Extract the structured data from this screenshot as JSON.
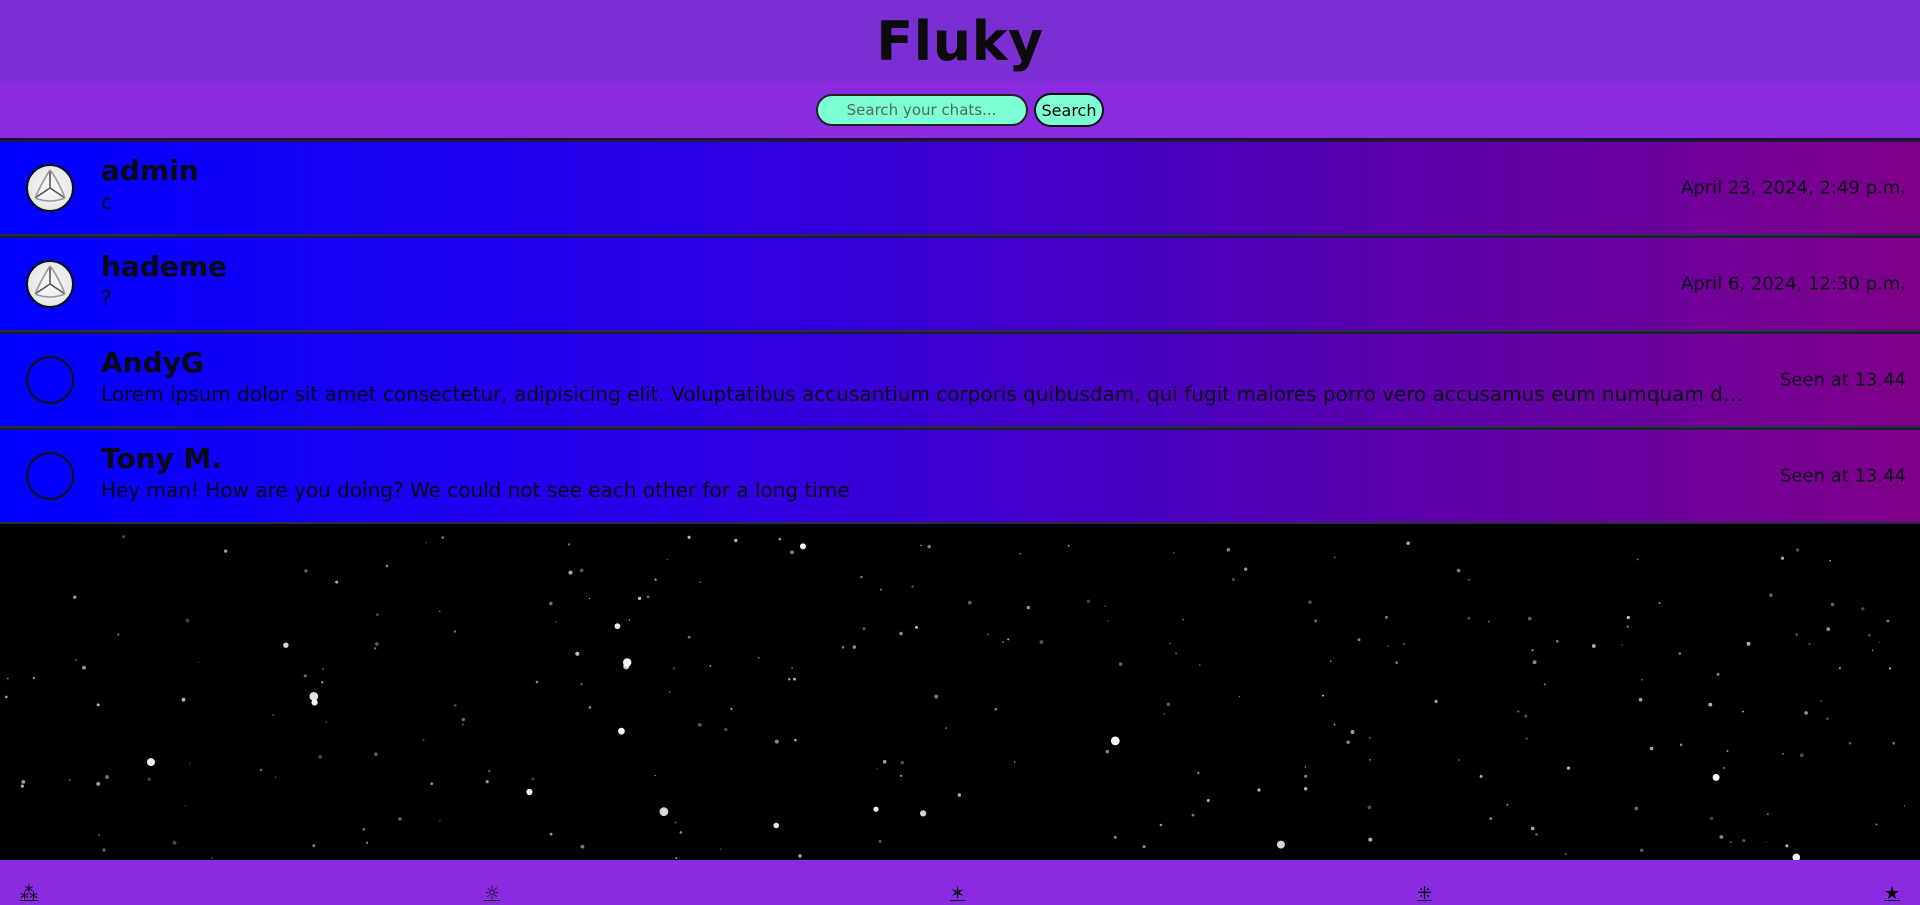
{
  "app": {
    "title": "Fluky"
  },
  "search": {
    "placeholder": "Search your chats...",
    "button_label": "Search"
  },
  "chats": [
    {
      "name": "admin",
      "message": "c",
      "time": "April 23, 2024, 2:49 p.m.",
      "avatar": "pattern"
    },
    {
      "name": "hademe",
      "message": "?",
      "time": "April 6, 2024, 12:30 p.m.",
      "avatar": "pattern"
    },
    {
      "name": "AndyG",
      "message": "Lorem ipsum dolor sit amet consectetur, adipisicing elit. Voluptatibus accusantium corporis quibusdam, qui fugit maiores porro vero accusamus eum numquam dolor dicta...",
      "time": "Seen at 13.44",
      "avatar": "empty"
    },
    {
      "name": "Tony M.",
      "message": "Hey man! How are you doing? We could not see each other for a long time",
      "time": "Seen at 13.44",
      "avatar": "empty"
    }
  ],
  "footer": {
    "icons": [
      {
        "glyph": "⁂",
        "name": "asterism-icon"
      },
      {
        "glyph": "☼",
        "name": "sun-icon"
      },
      {
        "glyph": "✶",
        "name": "star-icon"
      },
      {
        "glyph": "⁜",
        "name": "sparkle-icon"
      },
      {
        "glyph": "★",
        "name": "filled-star-icon"
      }
    ]
  },
  "colors": {
    "header": "#7a2fd3",
    "bar": "#8a2be2",
    "accent": "#7fffd4"
  }
}
